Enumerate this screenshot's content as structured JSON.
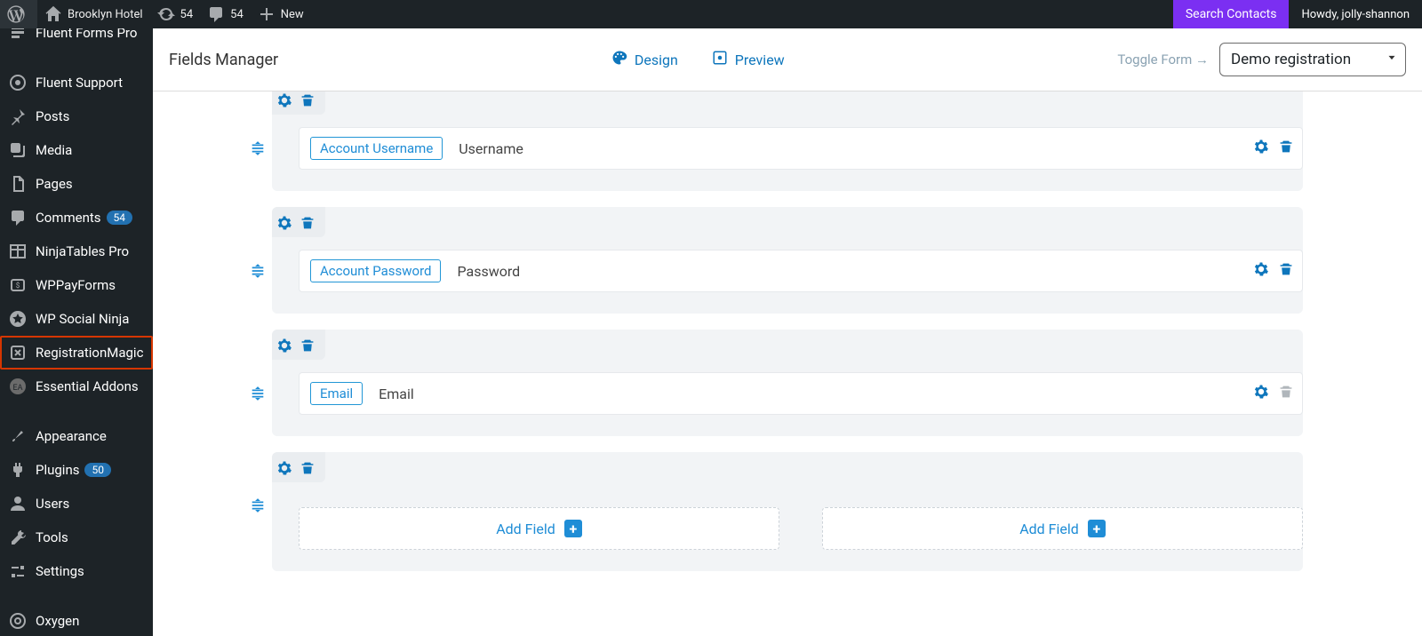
{
  "adminbar": {
    "site_name": "Brooklyn Hotel",
    "updates_count": "54",
    "comments_count": "54",
    "new_label": "New",
    "search_contacts": "Search Contacts",
    "howdy": "Howdy, jolly-shannon"
  },
  "sidebar": {
    "items": [
      {
        "label": "Fluent Forms Pro",
        "icon": "forms"
      },
      {
        "label": "Fluent Support",
        "icon": "support"
      },
      {
        "label": "Posts",
        "icon": "pin"
      },
      {
        "label": "Media",
        "icon": "media"
      },
      {
        "label": "Pages",
        "icon": "page"
      },
      {
        "label": "Comments",
        "icon": "comment",
        "badge": "54"
      },
      {
        "label": "NinjaTables Pro",
        "icon": "table"
      },
      {
        "label": "WPPayForms",
        "icon": "pay"
      },
      {
        "label": "WP Social Ninja",
        "icon": "star"
      },
      {
        "label": "RegistrationMagic",
        "icon": "magic",
        "highlight": true
      },
      {
        "label": "Essential Addons",
        "icon": "ea"
      },
      {
        "label": "Appearance",
        "icon": "brush"
      },
      {
        "label": "Plugins",
        "icon": "plug",
        "badge": "50"
      },
      {
        "label": "Users",
        "icon": "user"
      },
      {
        "label": "Tools",
        "icon": "wrench"
      },
      {
        "label": "Settings",
        "icon": "sliders"
      },
      {
        "label": "Oxygen",
        "icon": "oxygen"
      }
    ]
  },
  "header": {
    "title": "Fields Manager",
    "design": "Design",
    "preview": "Preview",
    "toggle_form": "Toggle Form →",
    "selected_form": "Demo registration"
  },
  "rows": [
    {
      "fields": [
        {
          "type": "Account Username",
          "label": "Username",
          "delete_enabled": true
        }
      ]
    },
    {
      "fields": [
        {
          "type": "Account Password",
          "label": "Password",
          "delete_enabled": true
        }
      ]
    },
    {
      "fields": [
        {
          "type": "Email",
          "label": "Email",
          "delete_enabled": false
        }
      ]
    },
    {
      "add_slots": 2,
      "add_label": "Add Field"
    }
  ]
}
